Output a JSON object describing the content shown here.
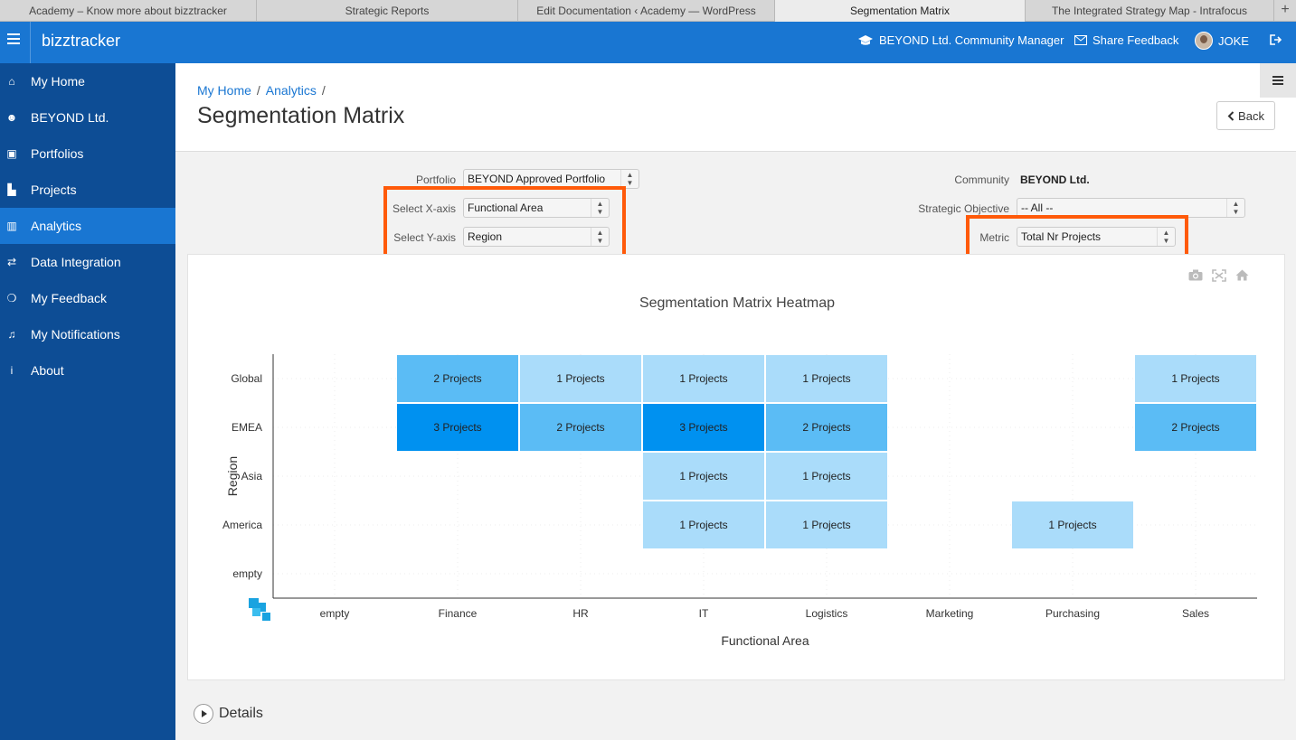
{
  "browser": {
    "tabs": [
      {
        "label": "Academy – Know more about bizztracker",
        "width": 284,
        "active": false
      },
      {
        "label": "Strategic Reports",
        "width": 289,
        "active": false
      },
      {
        "label": "Edit Documentation ‹ Academy — WordPress",
        "width": 284,
        "active": false
      },
      {
        "label": "Segmentation Matrix",
        "width": 277,
        "active": true
      },
      {
        "label": "The Integrated Strategy Map - Intrafocus",
        "width": 275,
        "active": false
      }
    ],
    "new_tab": "+"
  },
  "header": {
    "brand": "bizztracker",
    "community": "BEYOND Ltd. Community Manager",
    "feedback": "Share Feedback",
    "user": "JOKE"
  },
  "sidebar": {
    "items": [
      {
        "label": "My Home",
        "icon": "home-icon",
        "glyph": "⌂",
        "active": false
      },
      {
        "label": "BEYOND Ltd.",
        "icon": "users-icon",
        "glyph": "☻",
        "active": false
      },
      {
        "label": "Portfolios",
        "icon": "briefcase-icon",
        "glyph": "▣",
        "active": false
      },
      {
        "label": "Projects",
        "icon": "factory-icon",
        "glyph": "▙",
        "active": false
      },
      {
        "label": "Analytics",
        "icon": "bar-chart-icon",
        "glyph": "▥",
        "active": true
      },
      {
        "label": "Data Integration",
        "icon": "exchange-icon",
        "glyph": "⇄",
        "active": false
      },
      {
        "label": "My Feedback",
        "icon": "comments-icon",
        "glyph": "❍",
        "active": false
      },
      {
        "label": "My Notifications",
        "icon": "bell-icon",
        "glyph": "♫",
        "active": false
      },
      {
        "label": "About",
        "icon": "info-icon",
        "glyph": "i",
        "active": false
      }
    ]
  },
  "page": {
    "breadcrumb": [
      "My Home",
      "Analytics"
    ],
    "breadcrumb_sep": "/",
    "title": "Segmentation Matrix",
    "back_label": "Back"
  },
  "filters": {
    "portfolio_label": "Portfolio",
    "portfolio_value": "BEYOND Approved Portfolio",
    "x_axis_label": "Select X-axis",
    "x_axis_value": "Functional Area",
    "y_axis_label": "Select Y-axis",
    "y_axis_value": "Region",
    "community_label": "Community",
    "community_value": "BEYOND Ltd.",
    "objective_label": "Strategic Objective",
    "objective_value": "-- All --",
    "metric_label": "Metric",
    "metric_value": "Total Nr Projects",
    "highlight_color": "#ff5a0a"
  },
  "details_label": "Details",
  "colors": {
    "accent": "#1976d2",
    "sidebar": "#0d4d95",
    "heat_low": "#aadcfa",
    "heat_mid": "#5bbcf5",
    "heat_high": "#0091f0"
  },
  "chart_data": {
    "type": "heatmap",
    "title": "Segmentation Matrix Heatmap",
    "xlabel": "Functional Area",
    "ylabel": "Region",
    "x": [
      "empty",
      "Finance",
      "HR",
      "IT",
      "Logistics",
      "Marketing",
      "Purchasing",
      "Sales"
    ],
    "y": [
      "Global",
      "EMEA",
      "Asia",
      "America",
      "empty"
    ],
    "z": [
      [
        null,
        2,
        1,
        1,
        1,
        null,
        null,
        1
      ],
      [
        null,
        3,
        2,
        3,
        2,
        null,
        null,
        2
      ],
      [
        null,
        null,
        null,
        1,
        1,
        null,
        null,
        null
      ],
      [
        null,
        null,
        null,
        1,
        1,
        null,
        1,
        null
      ],
      [
        null,
        null,
        null,
        null,
        null,
        null,
        null,
        null
      ]
    ],
    "cell_label_suffix": " Projects",
    "grid": true
  }
}
